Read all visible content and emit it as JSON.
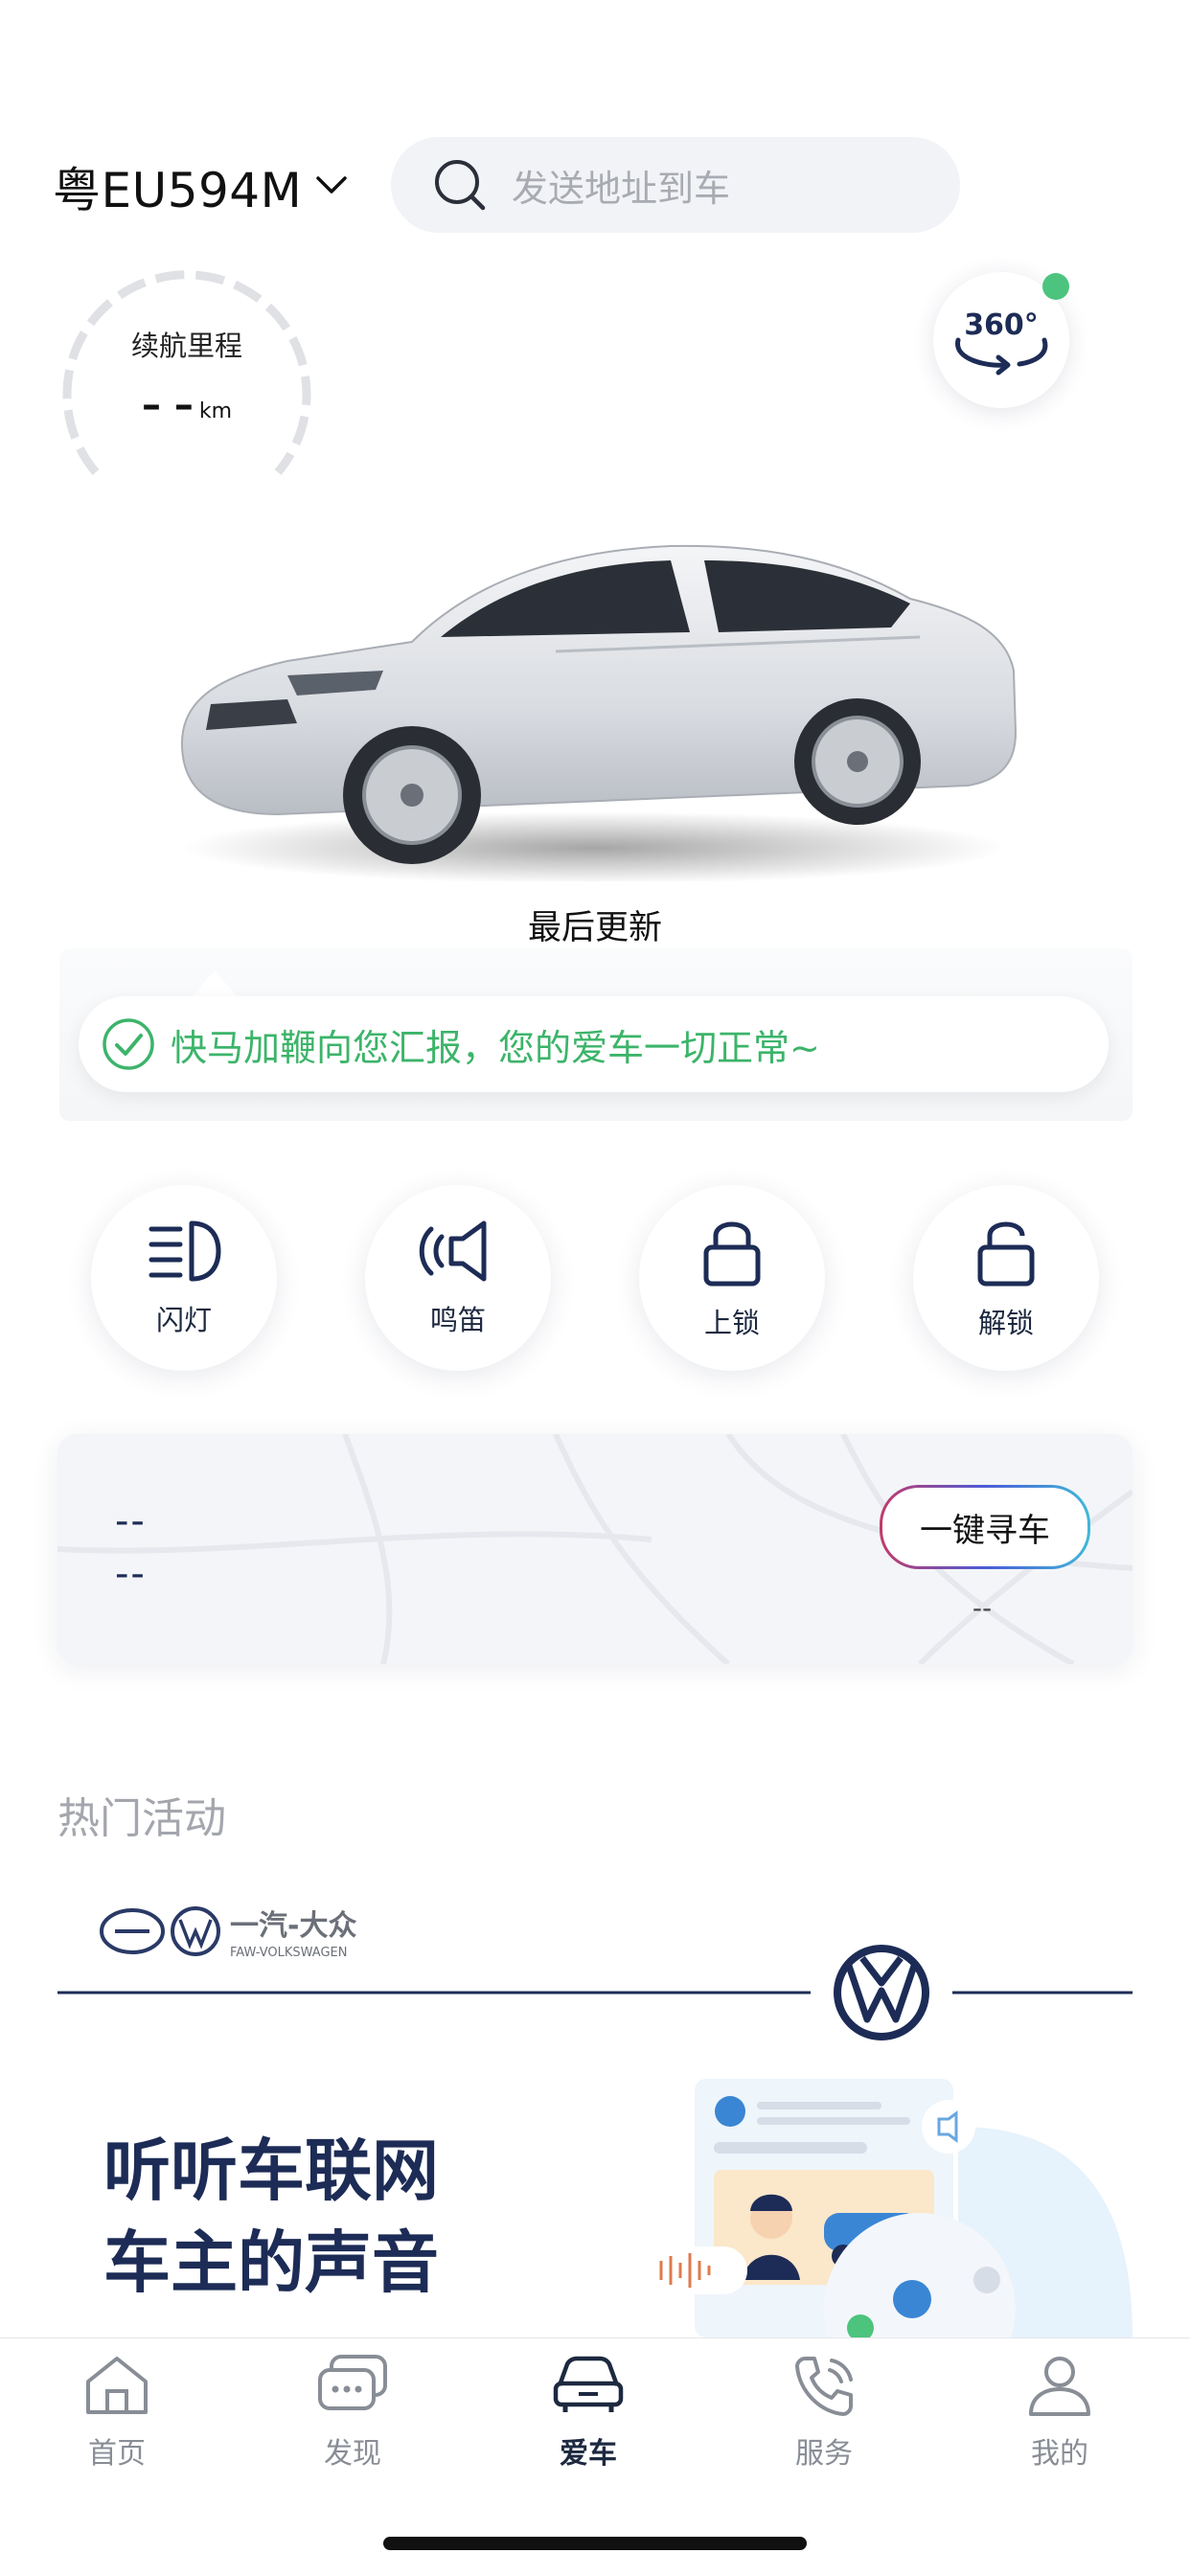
{
  "header": {
    "plate": "粤EU594M",
    "search_placeholder": "发送地址到车"
  },
  "range": {
    "label": "续航里程",
    "value": "– –",
    "unit": "km"
  },
  "view360": {
    "label": "360°"
  },
  "status": {
    "last_update": "最后更新",
    "message": "快马加鞭向您汇报，您的爱车一切正常~"
  },
  "actions": [
    {
      "label": "闪灯",
      "icon": "headlight-icon"
    },
    {
      "label": "鸣笛",
      "icon": "horn-icon"
    },
    {
      "label": "上锁",
      "icon": "lock-icon"
    },
    {
      "label": "解锁",
      "icon": "unlock-icon"
    }
  ],
  "find_car": {
    "line1": "--",
    "line2": "--",
    "button": "一键寻车",
    "distance": "--"
  },
  "hot": {
    "title": "热门活动",
    "banner_brand": "一汽-大众",
    "banner_brand_en": "FAW-VOLKSWAGEN",
    "banner_line1": "听听车联网",
    "banner_line2": "车主的声音"
  },
  "tabs": [
    {
      "label": "首页",
      "icon": "home-icon",
      "active": false
    },
    {
      "label": "发现",
      "icon": "discover-icon",
      "active": false
    },
    {
      "label": "爱车",
      "icon": "car-icon",
      "active": true
    },
    {
      "label": "服务",
      "icon": "phone-icon",
      "active": false
    },
    {
      "label": "我的",
      "icon": "user-icon",
      "active": false
    }
  ],
  "colors": {
    "accent_green": "#3cb46a",
    "navy": "#1d2940",
    "tab_inactive": "#888d96"
  }
}
